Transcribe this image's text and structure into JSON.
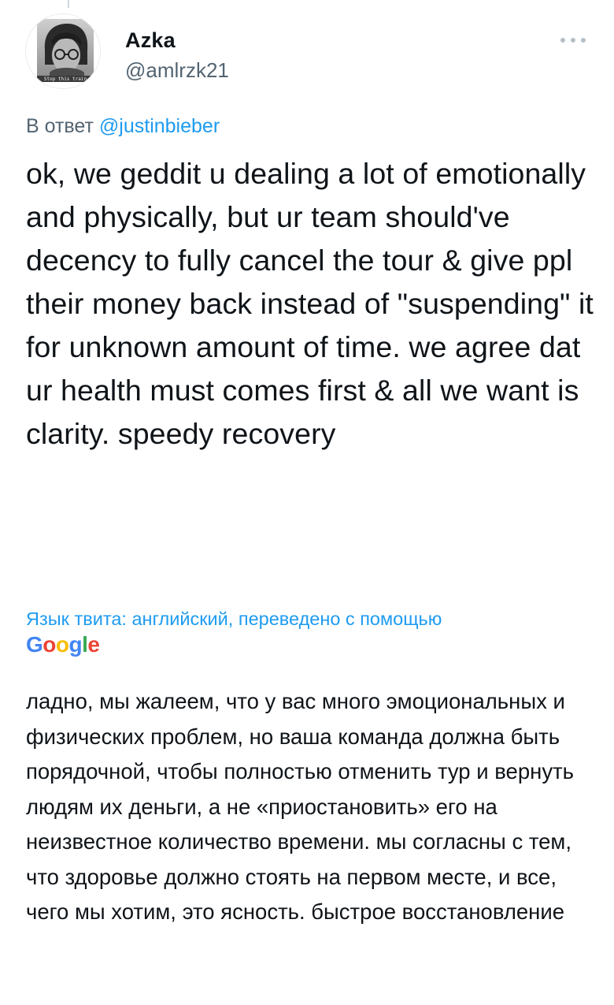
{
  "author": {
    "display_name": "Azka",
    "handle": "@amlrzk21",
    "avatar_caption": "Stop this train"
  },
  "reply": {
    "prefix": "В ответ",
    "mention": "@justinbieber"
  },
  "tweet": {
    "text": "ok, we geddit u dealing a lot of emotionally and physically, but ur team should've decency to fully cancel the tour & give ppl their money back instead of \"suspending\" it for unknown amount of time. we agree dat ur health must comes first & all we want is clarity. speedy recovery"
  },
  "translation": {
    "label": "Язык твита: английский, переведено с помощью",
    "provider": {
      "letters": [
        "G",
        "o",
        "o",
        "g",
        "l",
        "e"
      ],
      "colors": [
        "#4285f4",
        "#ea4335",
        "#fbbc05",
        "#4285f4",
        "#34a853",
        "#ea4335"
      ]
    },
    "text": "ладно, мы жалеем, что у вас много эмоциональных и физических проблем, но ваша команда должна быть порядочной, чтобы полностью отменить тур и вернуть людям их деньги, а не «приостановить» его на неизвестное количество времени. мы согласны с тем, что здоровье должно стоять на первом месте, и все, чего мы хотим, это ясность. быстрое восстановление"
  },
  "icons": {
    "more": "more-horizontal-icon"
  },
  "colors": {
    "accent": "#1d9bf0",
    "secondary_text": "#536471",
    "primary_text": "#0f1419"
  }
}
